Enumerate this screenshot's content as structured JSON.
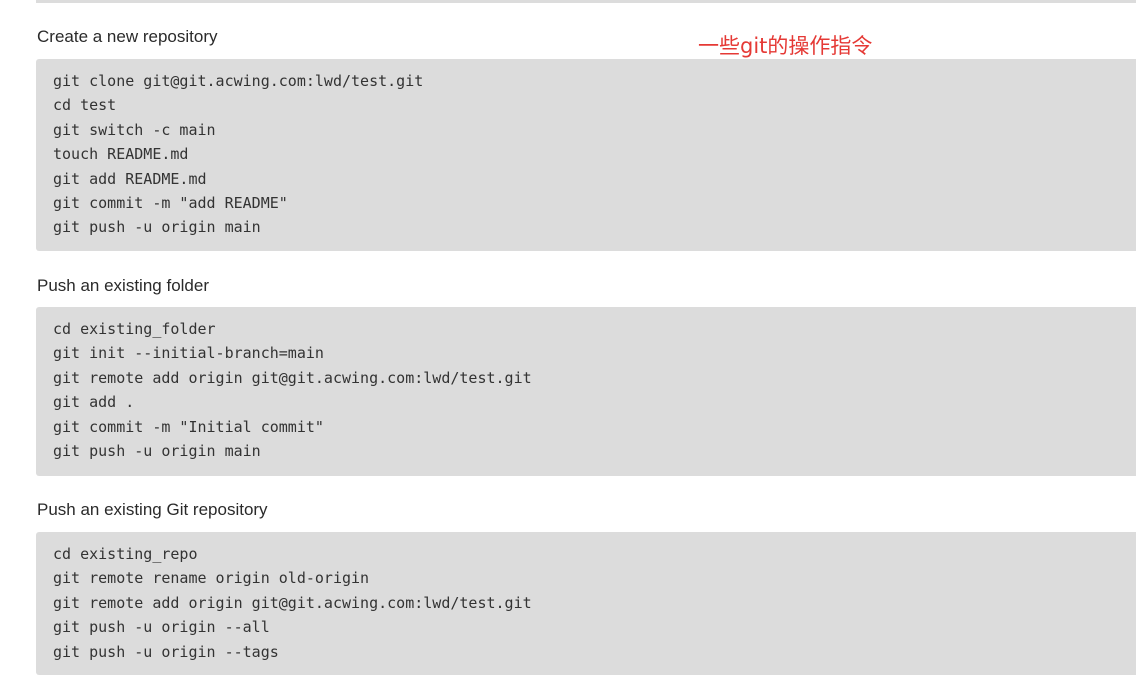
{
  "annotation": "一些git的操作指令",
  "sections": [
    {
      "title": "Create a new repository",
      "lines": [
        "git clone git@git.acwing.com:lwd/test.git",
        "cd test",
        "git switch -c main",
        "touch README.md",
        "git add README.md",
        "git commit -m \"add README\"",
        "git push -u origin main"
      ]
    },
    {
      "title": "Push an existing folder",
      "lines": [
        "cd existing_folder",
        "git init --initial-branch=main",
        "git remote add origin git@git.acwing.com:lwd/test.git",
        "git add .",
        "git commit -m \"Initial commit\"",
        "git push -u origin main"
      ]
    },
    {
      "title": "Push an existing Git repository",
      "lines": [
        "cd existing_repo",
        "git remote rename origin old-origin",
        "git remote add origin git@git.acwing.com:lwd/test.git",
        "git push -u origin --all",
        "git push -u origin --tags"
      ]
    }
  ]
}
